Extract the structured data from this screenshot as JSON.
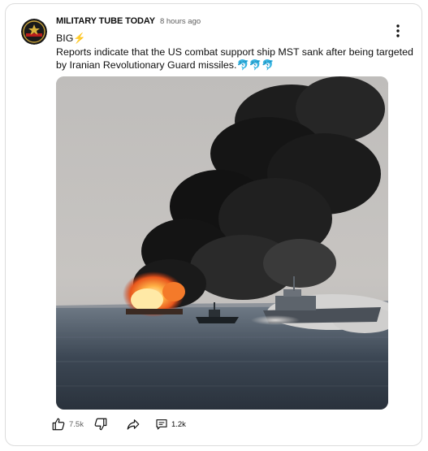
{
  "post": {
    "channel_name": "MILITARY TUBE TODAY",
    "time_ago": "8 hours ago",
    "headline": "BIG⚡",
    "body": "Reports indicate that the US combat support ship MST sank after being targeted by Iranian Revolutionary Guard missiles.🐬🐬🐬"
  },
  "actions": {
    "like_count": "7.5k",
    "comment_count": "1.2k"
  },
  "icons": {
    "menu": "more-vert-icon",
    "like": "thumbs-up-icon",
    "dislike": "thumbs-down-icon",
    "share": "share-icon",
    "comment": "comment-icon"
  },
  "colors": {
    "text_primary": "#0f0f0f",
    "text_secondary": "#606060",
    "card_border": "#dcdcdc"
  }
}
